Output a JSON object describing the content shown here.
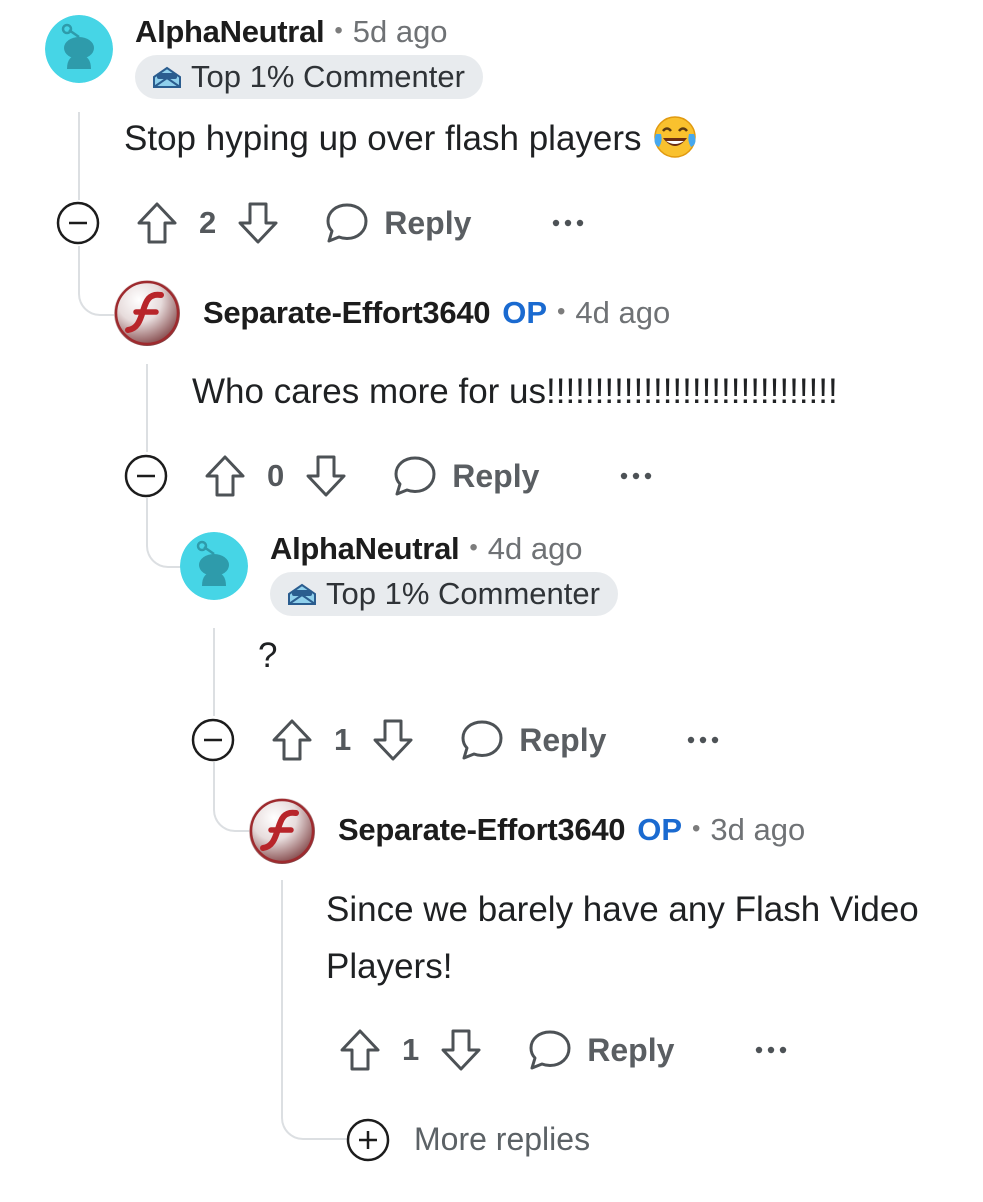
{
  "comments": [
    {
      "username": "AlphaNeutral",
      "time": "5d ago",
      "badge": "Top 1% Commenter",
      "text": "Stop hyping up over flash players",
      "emoji": "face-with-tears-of-joy",
      "score": "2",
      "reply_label": "Reply"
    },
    {
      "username": "Separate-Effort3640",
      "op_label": "OP",
      "time": "4d ago",
      "text": "Who cares more for us!!!!!!!!!!!!!!!!!!!!!!!!!!!!!!",
      "score": "0",
      "reply_label": "Reply"
    },
    {
      "username": "AlphaNeutral",
      "time": "4d ago",
      "badge": "Top 1% Commenter",
      "text": "?",
      "score": "1",
      "reply_label": "Reply"
    },
    {
      "username": "Separate-Effort3640",
      "op_label": "OP",
      "time": "3d ago",
      "text_lines": [
        "Since we barely have any Flash Video",
        "Players!"
      ],
      "score": "1",
      "reply_label": "Reply"
    }
  ],
  "separator": "•",
  "more_replies_label": "More replies",
  "icons": {
    "avatar_default": "snoo-avatar-icon",
    "avatar_flash": "flash-player-icon",
    "badge": "top-commenter-badge-icon",
    "upvote": "upvote-arrow-icon",
    "downvote": "downvote-arrow-icon",
    "reply": "speech-bubble-icon",
    "more": "ellipsis-icon",
    "collapse": "minus-circle-icon",
    "expand": "plus-circle-icon"
  },
  "colors": {
    "op": "#1a6ad0",
    "snoo_background": "#46d5e6",
    "flash_red": "#b8252a",
    "thread_line": "#dcdfe2"
  }
}
